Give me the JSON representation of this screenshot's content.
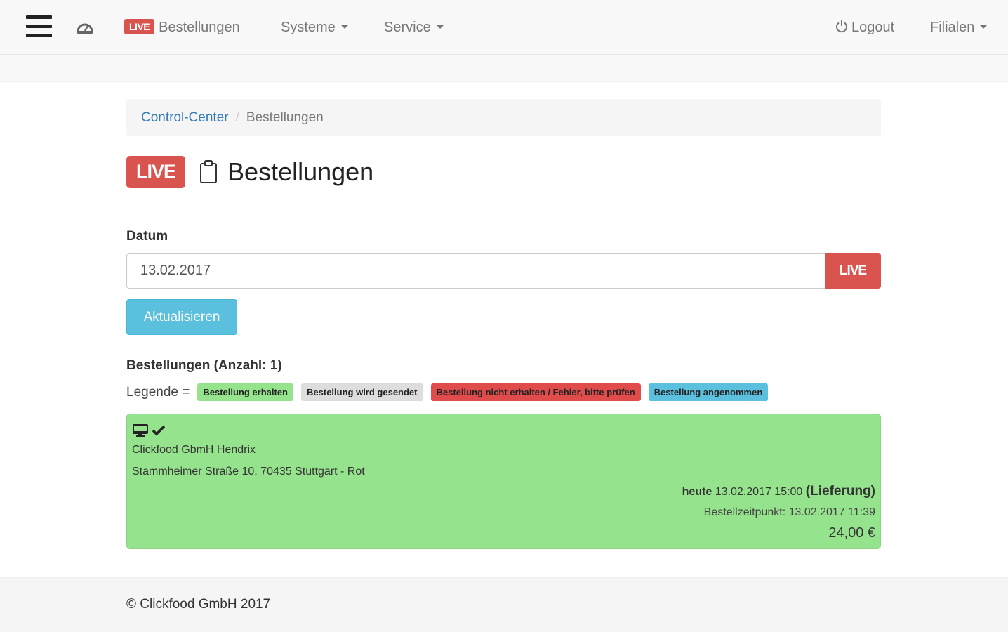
{
  "navbar": {
    "live_badge": "LIVE",
    "orders_label": "Bestellungen",
    "systems_label": "Systeme",
    "service_label": "Service",
    "logout_label": "Logout",
    "branches_label": "Filialen",
    "icons": [
      "menu-icon",
      "dashboard-icon",
      "power-icon",
      "caret-down-icon"
    ]
  },
  "breadcrumb": {
    "home": "Control-Center",
    "separator": "/",
    "current": "Bestellungen"
  },
  "page": {
    "live_badge": "LIVE",
    "title": "Bestellungen",
    "title_icon": "clipboard-icon"
  },
  "form": {
    "date_label": "Datum",
    "date_value": "13.02.2017",
    "live_addon": "LIVE",
    "refresh_button": "Aktualisieren"
  },
  "orders": {
    "heading": "Bestellungen (Anzahl: 1)",
    "legend_label": "Legende =",
    "legend": [
      {
        "label": "Bestellung erhalten",
        "color": "#96e38e"
      },
      {
        "label": "Bestellung wird gesendet",
        "color": "#dddddd"
      },
      {
        "label": "Bestellung nicht erhalten / Fehler, bitte prüfen",
        "color": "#e04b4b"
      },
      {
        "label": "Bestellung angenommen",
        "color": "#5bc0de"
      }
    ],
    "items": [
      {
        "status_color": "#96e38e",
        "icons": [
          "monitor-icon",
          "check-icon"
        ],
        "name": "Clickfood GbmH Hendrix",
        "address": "Stammheimer Straße 10, 70435 Stuttgart - Rot",
        "time_prefix": "heute",
        "time": "13.02.2017 15:00",
        "type": "(Lieferung)",
        "placed": "Bestellzeitpunkt: 13.02.2017 11:39",
        "total": "24,00 €"
      }
    ]
  },
  "footer": {
    "copyright": "© Clickfood GmbH 2017"
  },
  "colors": {
    "live_red": "#d9534f",
    "info_blue": "#5bc0de",
    "success_green": "#96e38e",
    "link_blue": "#337ab7"
  }
}
